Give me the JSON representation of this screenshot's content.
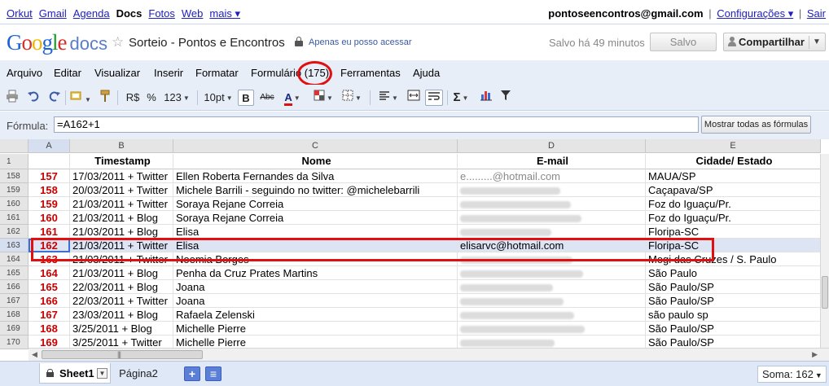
{
  "gbar": {
    "links": [
      "Orkut",
      "Gmail",
      "Agenda",
      "Docs",
      "Fotos",
      "Web"
    ],
    "current": "Docs",
    "more": "mais ▾",
    "email": "pontoseencontros@gmail.com",
    "settings": "Configurações ▾",
    "signout": "Sair"
  },
  "title": {
    "logo_docs": "docs",
    "doc_name": "Sorteio - Pontos e Encontros",
    "privacy": "Apenas eu posso acessar",
    "saved_time": "Salvo há 49 minutos",
    "save_btn": "Salvo",
    "share_btn": "Compartilhar"
  },
  "menu": {
    "items": [
      "Arquivo",
      "Editar",
      "Visualizar",
      "Inserir",
      "Formatar",
      "Formulário (175)",
      "Ferramentas",
      "Ajuda"
    ]
  },
  "toolbar": {
    "currency": "R$",
    "percent": "%",
    "number_format": "123",
    "font_size": "10pt",
    "bold": "B",
    "strike": "Abc",
    "text_color": "A",
    "sum": "Σ"
  },
  "formula": {
    "label": "Fórmula:",
    "value": "=A162+1",
    "show_all": "Mostrar todas as fórmulas"
  },
  "grid": {
    "columns": [
      "A",
      "B",
      "C",
      "D",
      "E"
    ],
    "header_row_num": "1",
    "headers": [
      "",
      "Timestamp",
      "Nome",
      "E-mail",
      "Cidade/ Estado"
    ],
    "rows": [
      {
        "rownum": "158",
        "a": "157",
        "b": "17/03/2011 + Twitter",
        "c": "Ellen Roberta Fernandes da Silva",
        "d": "e.........@hotmail.com",
        "e": "MAUA/SP"
      },
      {
        "rownum": "159",
        "a": "158",
        "b": "20/03/2011 + Twitter",
        "c": "Michele Barrili - seguindo no twitter: @michelebarrili",
        "d": "",
        "e": "Caçapava/SP"
      },
      {
        "rownum": "160",
        "a": "159",
        "b": "21/03/2011 + Twitter",
        "c": "Soraya Rejane Correia",
        "d": "",
        "e": "Foz do Iguaçu/Pr."
      },
      {
        "rownum": "161",
        "a": "160",
        "b": "21/03/2011 + Blog",
        "c": "Soraya Rejane Correia",
        "d": "",
        "e": "Foz do Iguaçu/Pr."
      },
      {
        "rownum": "162",
        "a": "161",
        "b": "21/03/2011 + Blog",
        "c": "Elisa",
        "d": "",
        "e": "Floripa-SC"
      },
      {
        "rownum": "163",
        "a": "162",
        "b": "21/03/2011 + Twitter",
        "c": "Elisa",
        "d": "elisarvc@hotmail.com",
        "e": "Floripa-SC"
      },
      {
        "rownum": "164",
        "a": "163",
        "b": "21/03/2011 + Twitter",
        "c": "Noemia Borges",
        "d": "",
        "e": "Mogi das Cruzes / S. Paulo"
      },
      {
        "rownum": "165",
        "a": "164",
        "b": "21/03/2011 + Blog",
        "c": "Penha da Cruz Prates Martins",
        "d": "",
        "e": "São Paulo"
      },
      {
        "rownum": "166",
        "a": "165",
        "b": "22/03/2011 + Blog",
        "c": "Joana",
        "d": "",
        "e": "São Paulo/SP"
      },
      {
        "rownum": "167",
        "a": "166",
        "b": "22/03/2011 + Twitter",
        "c": "Joana",
        "d": "",
        "e": "São Paulo/SP"
      },
      {
        "rownum": "168",
        "a": "167",
        "b": "23/03/2011 + Blog",
        "c": "Rafaela Zelenski",
        "d": "",
        "e": "são paulo sp"
      },
      {
        "rownum": "169",
        "a": "168",
        "b": "3/25/2011 + Blog",
        "c": "Michelle Pierre",
        "d": "",
        "e": "São Paulo/SP"
      },
      {
        "rownum": "170",
        "a": "169",
        "b": "3/25/2011 + Twitter",
        "c": "Michelle Pierre",
        "d": "",
        "e": "São Paulo/SP"
      }
    ]
  },
  "sheets": {
    "active": "Sheet1",
    "other": "Página2",
    "sum": "Soma: 162"
  }
}
